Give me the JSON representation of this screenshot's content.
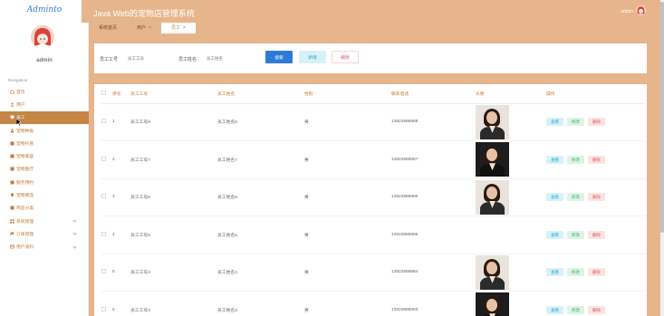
{
  "app": {
    "logo": "Adminto",
    "title": "Java Web的宠物店管理系统",
    "admin_name": "admin"
  },
  "sidebar": {
    "user": "admin",
    "heading": "Navigation",
    "items": [
      {
        "label": "首页",
        "icon": "home-icon",
        "active": false,
        "expandable": false
      },
      {
        "label": "用户",
        "icon": "user-icon",
        "active": false,
        "expandable": false
      },
      {
        "label": "员工",
        "icon": "monitor-icon",
        "active": true,
        "expandable": false
      },
      {
        "label": "宠物种类",
        "icon": "pet-icon",
        "active": false,
        "expandable": false
      },
      {
        "label": "宠物托管",
        "icon": "grid-icon",
        "active": false,
        "expandable": false
      },
      {
        "label": "宠物美容",
        "icon": "grid-icon",
        "active": false,
        "expandable": false
      },
      {
        "label": "宠物医疗",
        "icon": "grid-icon",
        "active": false,
        "expandable": false
      },
      {
        "label": "服务预约",
        "icon": "grid-icon",
        "active": false,
        "expandable": false
      },
      {
        "label": "宠物商品",
        "icon": "pin-icon",
        "active": false,
        "expandable": false
      },
      {
        "label": "商品分类",
        "icon": "grid-icon",
        "active": false,
        "expandable": false
      },
      {
        "label": "系统管理",
        "icon": "apps-icon",
        "active": false,
        "expandable": true
      },
      {
        "label": "订单管理",
        "icon": "flag-icon",
        "active": false,
        "expandable": true
      },
      {
        "label": "用户资料",
        "icon": "mail-icon",
        "active": false,
        "expandable": true
      }
    ]
  },
  "tabs": [
    {
      "label": "系统首页",
      "closable": false,
      "active": false
    },
    {
      "label": "用户",
      "closable": true,
      "active": false
    },
    {
      "label": "员工",
      "closable": true,
      "active": true
    }
  ],
  "search": {
    "id_label": "员工工号",
    "id_placeholder": "员工工号",
    "name_label": "员工姓名",
    "name_placeholder": "员工姓名",
    "search_btn": "搜索",
    "add_btn": "新增",
    "delete_btn": "删除"
  },
  "table": {
    "headers": [
      "序号",
      "员工工号",
      "员工姓名",
      "性别",
      "联系电话",
      "头像",
      "操作"
    ],
    "actions": {
      "view": "查看",
      "edit": "修改",
      "delete": "删除"
    },
    "rows": [
      {
        "no": "1",
        "id": "员工工号8",
        "name": "员工姓名8",
        "sex": "男",
        "phone": "13823888888",
        "photo": "light"
      },
      {
        "no": "2",
        "id": "员工工号7",
        "name": "员工姓名7",
        "sex": "男",
        "phone": "13823888887",
        "photo": "dark"
      },
      {
        "no": "3",
        "id": "员工工号6",
        "name": "员工姓名6",
        "sex": "男",
        "phone": "13823888886",
        "photo": "light"
      },
      {
        "no": "4",
        "id": "员工工号5",
        "name": "员工姓名5",
        "sex": "男",
        "phone": "13823888885",
        "photo": "none"
      },
      {
        "no": "5",
        "id": "员工工号4",
        "name": "员工姓名4",
        "sex": "男",
        "phone": "13823888884",
        "photo": "light"
      },
      {
        "no": "6",
        "id": "员工工号3",
        "name": "员工姓名3",
        "sex": "男",
        "phone": "13823888883",
        "photo": "dark"
      }
    ]
  },
  "colors": {
    "accent": "#e7b58b",
    "active_nav": "#c58545",
    "primary": "#2e7bd6"
  }
}
